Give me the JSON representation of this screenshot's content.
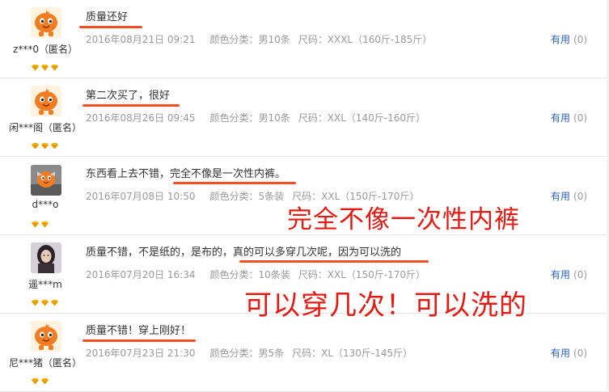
{
  "reviews": [
    {
      "user": "z***0（匿名）",
      "avatar": "orange-mascot",
      "content": "质量还好",
      "date": "2016年08月21日 09:21",
      "color": "颜色分类：男10条",
      "size": "尺码：XXXL（160斤-185斤）",
      "useful_label": "有用",
      "useful_count": "(0)"
    },
    {
      "user": "闲***阁（匿名）",
      "avatar": "orange-mascot",
      "content": "第二次买了，很好",
      "date": "2016年08月26日 09:45",
      "color": "颜色分类：男10条",
      "size": "尺码：XXL（140斤-160斤）",
      "useful_label": "有用",
      "useful_count": "(0)"
    },
    {
      "user": "d***o",
      "avatar": "custom-photo",
      "content": "东西看上去不错，完全不像是一次性内裤。",
      "date": "2016年07月08日 10:50",
      "color": "颜色分类：5条装",
      "size": "尺码：XXL（150斤-170斤）",
      "useful_label": "有用",
      "useful_count": "(0)"
    },
    {
      "user": "遥***m",
      "avatar": "custom-photo-dark",
      "content": "质量不错，不是纸的，是布的，真的可以多穿几次呢，因为可以洗的",
      "date": "2016年07月20日 16:34",
      "color": "颜色分类：10条装",
      "size": "尺码：XXL（150斤-170斤）",
      "useful_label": "有用",
      "useful_count": "(0)"
    },
    {
      "user": "尼***猪（匿名）",
      "avatar": "orange-mascot",
      "content": "质量不错！穿上刚好！",
      "date": "2016年07月23日 21:30",
      "color": "颜色分类：男5条",
      "size": "尺码：XL（130斤-145斤）",
      "useful_label": "有用",
      "useful_count": "(0)"
    }
  ],
  "overlays": {
    "text1": "完全不像一次性内裤",
    "text2": "可以穿几次！可以洗的"
  },
  "colors": {
    "annotation_red": "#e41b12",
    "underline_orange": "#f04e23",
    "link_blue": "#2b62b7",
    "meta_gray": "#9a9a9a",
    "badge_gold": "#f5b400"
  }
}
